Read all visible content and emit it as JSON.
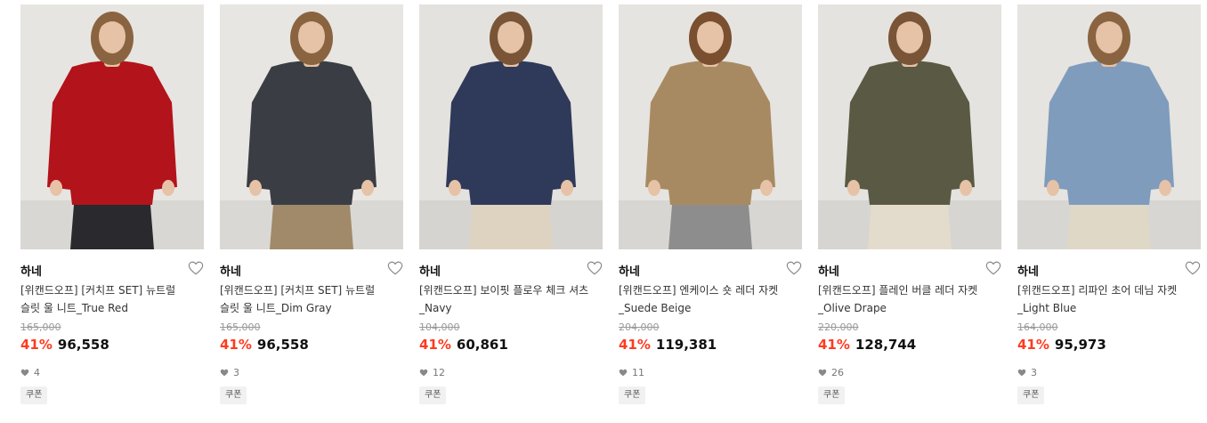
{
  "products": [
    {
      "brand": "하네",
      "title_line1": "[위캔드오프] [커치프 SET] 뉴트럴",
      "title_line2": "슬릿 울 니트_True Red",
      "original_price": "165,000",
      "discount": "41%",
      "price": "96,558",
      "likes": "4",
      "badge": "쿠폰",
      "colors": {
        "bg": "#e7e5e1",
        "top": "#b3131b",
        "bottom": "#2a2a2e",
        "hair": "#8a6440",
        "skin": "#e6c2a6"
      }
    },
    {
      "brand": "하네",
      "title_line1": "[위캔드오프] [커치프 SET] 뉴트럴",
      "title_line2": "슬릿 울 니트_Dim Gray",
      "original_price": "165,000",
      "discount": "41%",
      "price": "96,558",
      "likes": "3",
      "badge": "쿠폰",
      "colors": {
        "bg": "#e8e6e2",
        "top": "#3a3d44",
        "bottom": "#a08a6a",
        "hair": "#8a6440",
        "skin": "#e6c2a6"
      }
    },
    {
      "brand": "하네",
      "title_line1": "[위캔드오프] 보이핏 플로우 체크 셔츠",
      "title_line2": "_Navy",
      "original_price": "104,000",
      "discount": "41%",
      "price": "60,861",
      "likes": "12",
      "badge": "쿠폰",
      "colors": {
        "bg": "#e4e2de",
        "top": "#2f3a5a",
        "bottom": "#ddd3c0",
        "hair": "#7a5436",
        "skin": "#e6c2a6"
      }
    },
    {
      "brand": "하네",
      "title_line1": "[위캔드오프] 엔케이스 숏 레더 자켓",
      "title_line2": "_Suede Beige",
      "original_price": "204,000",
      "discount": "41%",
      "price": "119,381",
      "likes": "11",
      "badge": "쿠폰",
      "colors": {
        "bg": "#e6e4e0",
        "top": "#a88a62",
        "bottom": "#8d8d8d",
        "hair": "#7a4f30",
        "skin": "#e6c2a6"
      }
    },
    {
      "brand": "하네",
      "title_line1": "[위캔드오프] 플레인 버클 레더 자켓",
      "title_line2": "_Olive Drape",
      "original_price": "220,000",
      "discount": "41%",
      "price": "128,744",
      "likes": "26",
      "badge": "쿠폰",
      "colors": {
        "bg": "#e5e3df",
        "top": "#5a5a44",
        "bottom": "#e3dccd",
        "hair": "#7a5436",
        "skin": "#e6c2a6"
      }
    },
    {
      "brand": "하네",
      "title_line1": "[위캔드오프] 리파인 초어 데님 자켓",
      "title_line2": "_Light Blue",
      "original_price": "164,000",
      "discount": "41%",
      "price": "95,973",
      "likes": "3",
      "badge": "쿠폰",
      "colors": {
        "bg": "#e6e4e0",
        "top": "#7f9cbd",
        "bottom": "#e0d8c6",
        "hair": "#8a6440",
        "skin": "#e6c2a6"
      }
    }
  ],
  "icons": {
    "wishlist": "heart-outline-icon",
    "likes": "heart-filled-icon"
  },
  "accent_colors": {
    "discount": "#ff3b1f",
    "strike": "#999999"
  }
}
